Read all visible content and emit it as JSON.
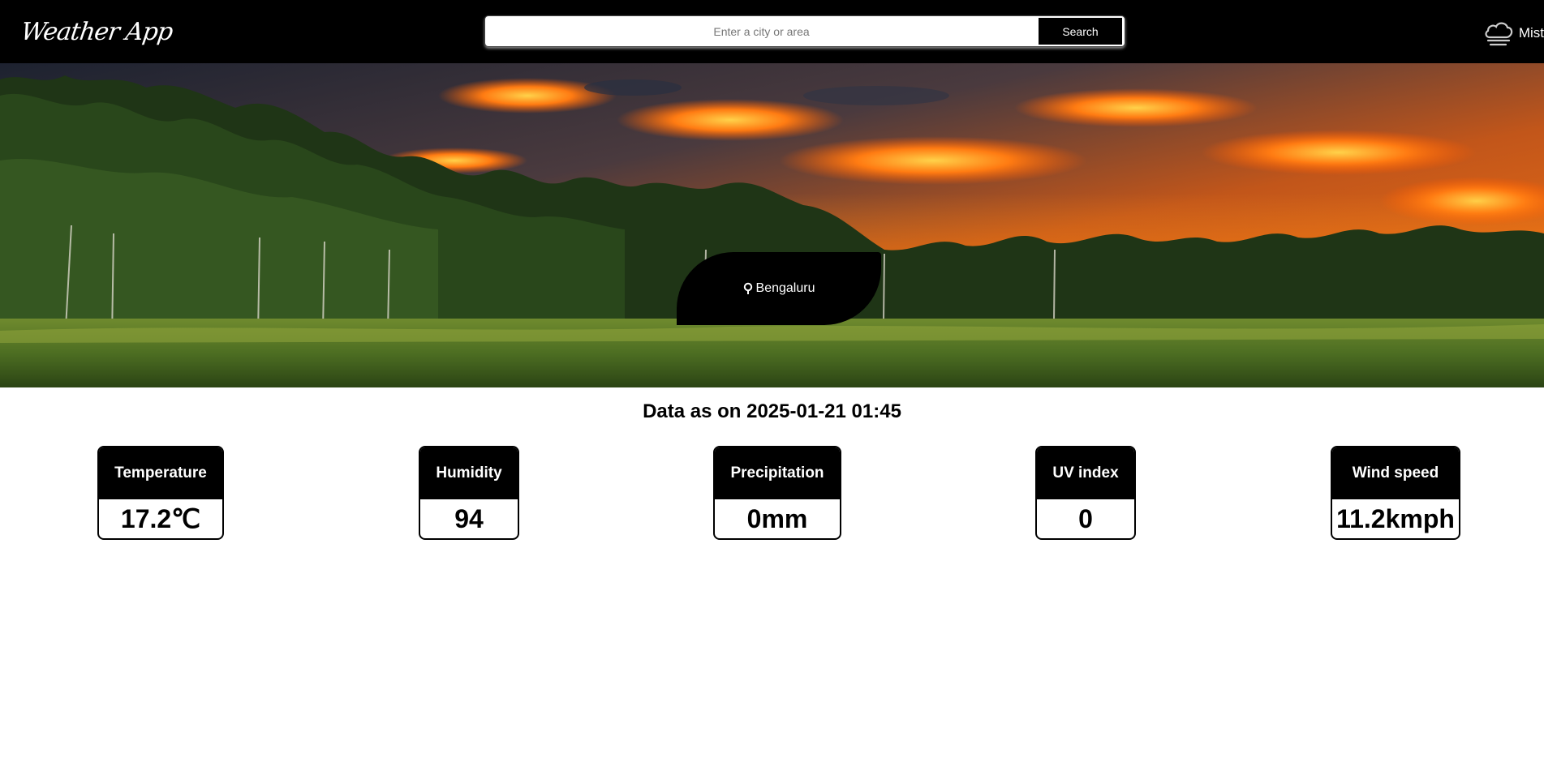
{
  "header": {
    "logo_text": "Weather App",
    "search": {
      "placeholder": "Enter a city or area",
      "value": "",
      "button_label": "Search"
    },
    "condition": {
      "icon": "cloud-fog-icon",
      "label": "Mist"
    }
  },
  "hero": {
    "location": {
      "icon": "map-pin-icon",
      "name": "Bengaluru"
    }
  },
  "report": {
    "as_of_label": "Data as on",
    "as_of_value": "2025-01-21 01:45"
  },
  "metrics": [
    {
      "label": "Temperature",
      "value": "17.2℃"
    },
    {
      "label": "Humidity",
      "value": "94"
    },
    {
      "label": "Precipitation",
      "value": "0mm"
    },
    {
      "label": "UV index",
      "value": "0"
    },
    {
      "label": "Wind speed",
      "value": "11.2kmph"
    }
  ],
  "colors": {
    "header_bg": "#000000",
    "card_header_bg": "#000000",
    "text_on_dark": "#ffffff"
  }
}
